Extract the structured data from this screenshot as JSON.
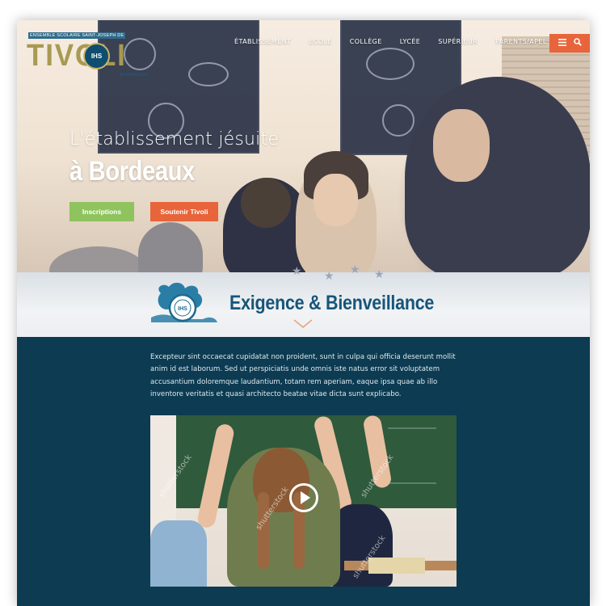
{
  "header": {
    "logo": {
      "tagline": "ENSEMBLE SCOLAIRE SAINT-JOSEPH DE",
      "wordmark": "TIVOLI",
      "seal_text": "IHS",
      "city": "BORDEAUX"
    },
    "nav": [
      {
        "label": "ÉTABLISSEMENT"
      },
      {
        "label": "ECOLE"
      },
      {
        "label": "COLLÈGE"
      },
      {
        "label": "LYCÉE"
      },
      {
        "label": "SUPÉRIEUR"
      },
      {
        "label": "PARENTS/APEL"
      }
    ],
    "menu_icon": "hamburger-icon",
    "search_icon": "search-icon"
  },
  "hero": {
    "title_line1": "L'établissement jésuite",
    "title_line2": "à Bordeaux",
    "buttons": {
      "inscriptions": "Inscriptions",
      "soutenir": "Soutenir Tivoli"
    }
  },
  "motto": {
    "text": "Exigence & Bienveillance"
  },
  "content": {
    "paragraph": "Excepteur sint occaecat cupidatat non proident, sunt in culpa qui officia deserunt mollit anim id est laborum. Sed ut perspiciatis unde omnis iste natus error sit voluptatem accusantium doloremque laudantium, totam rem aperiam, eaque ipsa quae ab illo inventore veritatis et quasi architecto beatae vitae dicta sunt explicabo.",
    "video": {
      "watermark": "shutterstock",
      "play_icon": "play-icon"
    }
  },
  "colors": {
    "navy": "#0c3b52",
    "green": "#8fc35e",
    "orange": "#e8643a",
    "motto_blue": "#17557a",
    "gold": "#a89a52"
  }
}
